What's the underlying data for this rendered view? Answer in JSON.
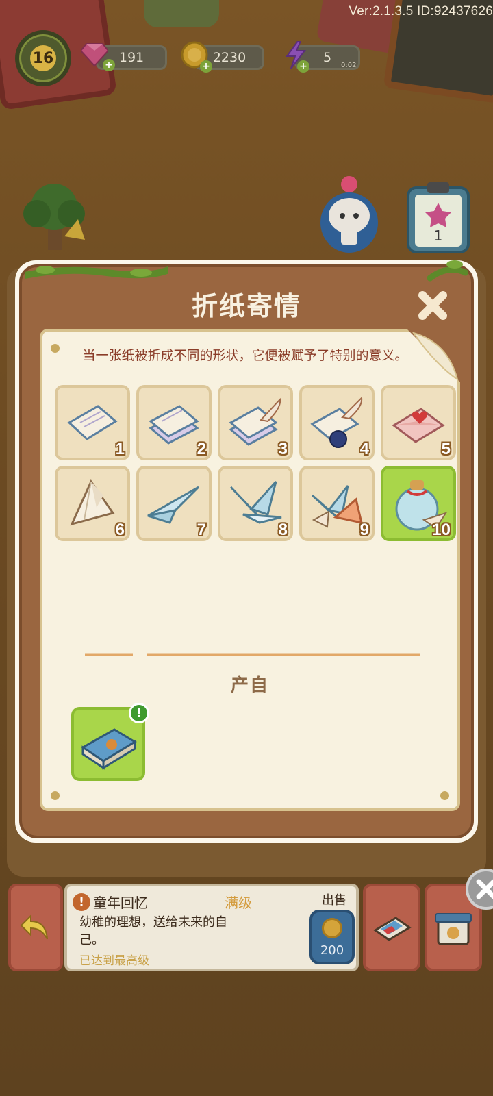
{
  "hud": {
    "version": "Ver:2.1.3.5 ID:92437626",
    "level": "16",
    "gems": "191",
    "coins": "2230",
    "energy": "5",
    "energy_timer": "0:02",
    "gem_icon": "pink-gem-icon",
    "coin_icon": "gold-coin-icon",
    "energy_icon": "lightning-icon"
  },
  "background_icons": {
    "clipboard_count": "1"
  },
  "modal": {
    "title": "折纸寄情",
    "description": "当一张纸被折成不同的形状，它便被赋予了特别的意义。",
    "items": [
      {
        "num": "1",
        "icon": "paper-sheet-icon"
      },
      {
        "num": "2",
        "icon": "paper-stack-icon"
      },
      {
        "num": "3",
        "icon": "paper-quill-icon"
      },
      {
        "num": "4",
        "icon": "letter-ink-icon"
      },
      {
        "num": "5",
        "icon": "heart-envelope-icon"
      },
      {
        "num": "6",
        "icon": "paper-fold-icon"
      },
      {
        "num": "7",
        "icon": "paper-plane-icon"
      },
      {
        "num": "8",
        "icon": "paper-crane-icon"
      },
      {
        "num": "9",
        "icon": "crane-group-icon"
      },
      {
        "num": "10",
        "icon": "crane-bottle-icon"
      }
    ],
    "source_label": "产自",
    "source_item_icon": "storybook-icon"
  },
  "info": {
    "name": "童年回忆",
    "level_status": "满级",
    "desc": "幼稚的理想，送给未来的自己。",
    "max_status": "已达到最高级",
    "sell_label": "出售",
    "sell_price": "200"
  },
  "colors": {
    "frame_brown": "#9a6640",
    "paper": "#f8f2e0",
    "active_green": "#a9d64a",
    "title_text": "#f8f1e1"
  }
}
